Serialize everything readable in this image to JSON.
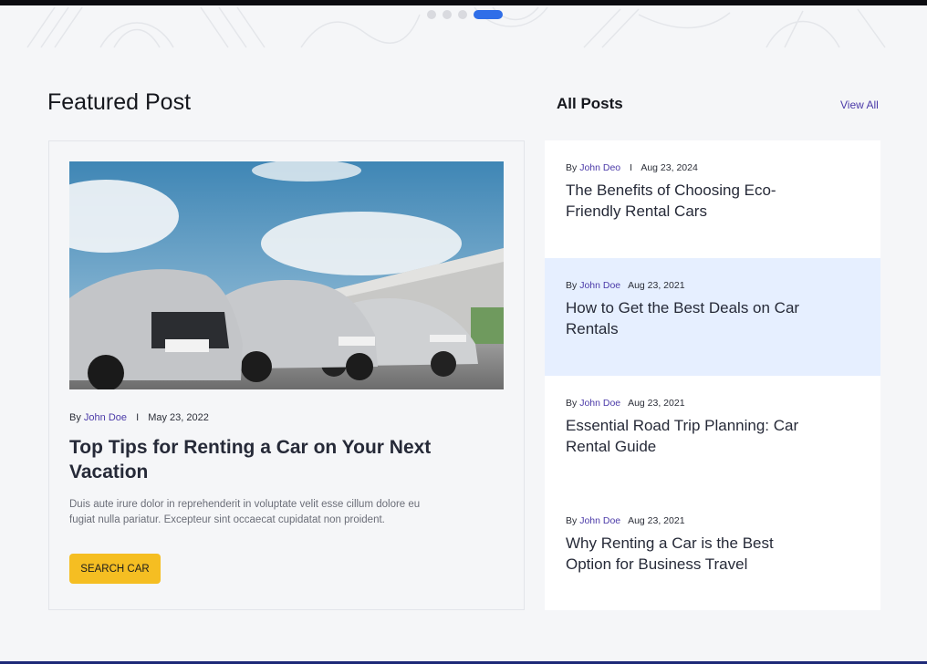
{
  "carousel": {
    "total_dots": 4,
    "active_index": 3
  },
  "featured": {
    "section_title": "Featured Post",
    "by_label": "By",
    "author": "John Doe",
    "separator": "I",
    "date": "May 23, 2022",
    "title": "Top Tips for Renting a Car on Your Next Vacation",
    "excerpt": "Duis aute irure dolor in reprehenderit in voluptate velit esse cillum dolore eu fugiat nulla pariatur. Excepteur sint occaecat cupidatat non proident.",
    "button_label": "SEARCH CAR"
  },
  "all_posts": {
    "title": "All Posts",
    "view_all_label": "View All",
    "items": [
      {
        "by_label": "By",
        "author": "John Deo",
        "separator": "I",
        "date": "Aug 23, 2024",
        "title": "The Benefits of Choosing Eco-Friendly Rental Cars",
        "highlighted": false
      },
      {
        "by_label": "By",
        "author": "John Doe",
        "separator": "",
        "date": "Aug 23, 2021",
        "title": "How to Get the Best Deals on Car Rentals",
        "highlighted": true
      },
      {
        "by_label": "By",
        "author": "John Doe",
        "separator": "",
        "date": "Aug 23, 2021",
        "title": "Essential Road Trip Planning: Car Rental Guide",
        "highlighted": false
      },
      {
        "by_label": "By",
        "author": "John Doe",
        "separator": "",
        "date": "Aug 23, 2021",
        "title": "Why Renting a Car is the Best Option for Business Travel",
        "highlighted": false
      }
    ]
  },
  "colors": {
    "accent": "#2f6ee8",
    "author": "#4b3aa8",
    "button": "#f5be22",
    "highlight": "#e6efff"
  }
}
